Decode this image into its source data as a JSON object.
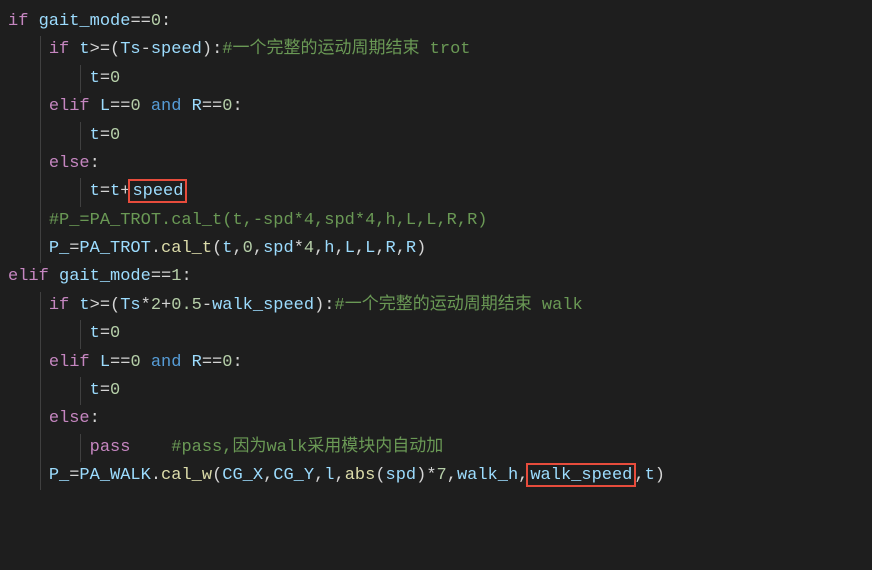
{
  "code": {
    "l1": {
      "kw_if": "if",
      "var": "gait_mode",
      "op": "==",
      "num": "0",
      "colon": ":"
    },
    "l2": {
      "indent": "    ",
      "kw_if": "if",
      "var_t": "t",
      "op1": ">=",
      "paren_o": "(",
      "var_ts": "Ts",
      "minus": "-",
      "var_speed": "speed",
      "paren_c": ")",
      "colon": ":",
      "cmt": "#一个完整的运动周期结束 trot"
    },
    "l3": {
      "indent": "        ",
      "var_t": "t",
      "eq": "=",
      "num": "0"
    },
    "l4": {
      "indent": "    ",
      "kw_elif": "elif",
      "var_l": "L",
      "op1": "==",
      "num_0a": "0",
      "kw_and": "and",
      "var_r": "R",
      "op2": "==",
      "num_0b": "0",
      "colon": ":"
    },
    "l5": {
      "indent": "        ",
      "var_t": "t",
      "eq": "=",
      "num": "0"
    },
    "l6": {
      "indent": "    ",
      "kw_else": "else",
      "colon": ":"
    },
    "l7": {
      "indent": "        ",
      "var_t": "t",
      "eq": "=",
      "var_t2": "t",
      "plus": "+",
      "hl": "speed"
    },
    "l8": {
      "indent": "    ",
      "cmt": "#P_=PA_TROT.cal_t(t,-spd*4,spd*4,h,L,L,R,R)"
    },
    "l9": {
      "indent": "    ",
      "var_p": "P_",
      "eq": "=",
      "var_pa": "PA_TROT",
      "dot": ".",
      "fn": "cal_t",
      "args_open": "(",
      "a1": "t",
      "c1": ",",
      "a2": "0",
      "c2": ",",
      "a3": "spd",
      "mul": "*",
      "a4": "4",
      "c3": ",",
      "a5": "h",
      "c4": ",",
      "a6": "L",
      "c5": ",",
      "a7": "L",
      "c6": ",",
      "a8": "R",
      "c7": ",",
      "a9": "R",
      "args_close": ")"
    },
    "l10": {
      "kw_elif": "elif",
      "var": "gait_mode",
      "op": "==",
      "num": "1",
      "colon": ":"
    },
    "l11": {
      "indent": "    ",
      "kw_if": "if",
      "var_t": "t",
      "op1": ">=",
      "paren_o": "(",
      "var_ts": "Ts",
      "mul": "*",
      "num2": "2",
      "plus": "+",
      "num_05": "0.5",
      "minus": "-",
      "var_ws": "walk_speed",
      "paren_c": ")",
      "colon": ":",
      "cmt": "#一个完整的运动周期结束 walk"
    },
    "l12": {
      "indent": "        ",
      "var_t": "t",
      "eq": "=",
      "num": "0"
    },
    "l13": {
      "indent": "    ",
      "kw_elif": "elif",
      "var_l": "L",
      "op1": "==",
      "num_0a": "0",
      "kw_and": "and",
      "var_r": "R",
      "op2": "==",
      "num_0b": "0",
      "colon": ":"
    },
    "l14": {
      "indent": "        ",
      "var_t": "t",
      "eq": "=",
      "num": "0"
    },
    "l15": {
      "indent": "    ",
      "kw_else": "else",
      "colon": ":"
    },
    "l16": {
      "indent": "        ",
      "kw_pass": "pass",
      "sp": "    ",
      "cmt": "#pass,因为walk采用模块内自动加"
    },
    "l17": {
      "indent": "    ",
      "var_p": "P_",
      "eq": "=",
      "var_pa": "PA_WALK",
      "dot": ".",
      "fn": "cal_w",
      "args_open": "(",
      "a1": "CG_X",
      "c1": ",",
      "a2": "CG_Y",
      "c2": ",",
      "a3": "l",
      "c3": ",",
      "fn_abs": "abs",
      "po": "(",
      "a4": "spd",
      "pc": ")",
      "mul": "*",
      "a5": "7",
      "c4": ",",
      "a6": "walk_h",
      "c5": ",",
      "hl": "walk_speed",
      "c6": ",",
      "a7": "t",
      "args_close": ")"
    }
  }
}
